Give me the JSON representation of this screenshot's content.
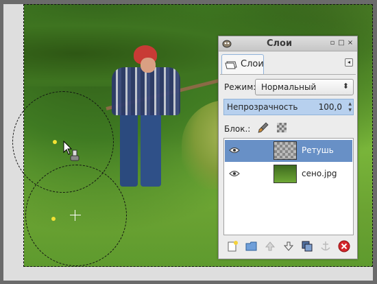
{
  "dock": {
    "title": "Слои",
    "tab_label": "Слои",
    "mode_label": "Режим:",
    "mode_value": "Нормальный",
    "opacity_label": "Непрозрачность",
    "opacity_value": "100,0",
    "opacity_fraction": 1.0,
    "lock_label": "Блок.:",
    "layers": [
      {
        "name": "Ретушь",
        "selected": true,
        "visible": true,
        "thumbnail": "transparent"
      },
      {
        "name": "сено.jpg",
        "selected": false,
        "visible": true,
        "thumbnail": "photo"
      }
    ],
    "bottom_buttons": [
      "new-layer-icon",
      "new-group-icon",
      "raise-layer-icon",
      "lower-layer-icon",
      "duplicate-layer-icon",
      "anchor-layer-icon",
      "delete-layer-icon"
    ],
    "window_buttons": [
      "minimize-icon",
      "maximize-icon",
      "close-icon"
    ]
  },
  "canvas": {
    "tool": "healing-tool",
    "image_description_icons": [
      "brush-outline",
      "crosshair",
      "mouse-cursor"
    ]
  },
  "colors": {
    "selection_highlight": "#6890c6",
    "delete_red": "#d4262b"
  }
}
